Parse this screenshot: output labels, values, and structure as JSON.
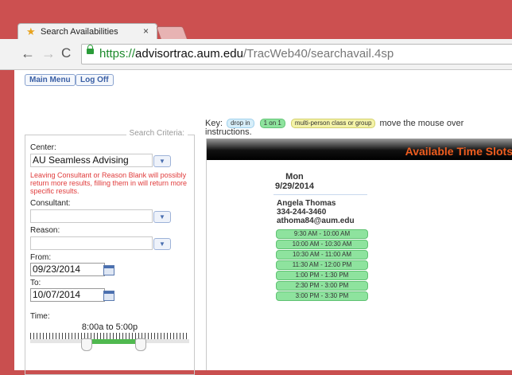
{
  "browser": {
    "tab_title": "Search Availabilities",
    "tab_close": "×",
    "url_scheme": "https://",
    "url_host": "advisortrac.aum.edu",
    "url_path": "/TracWeb40/searchavail.4sp"
  },
  "nav": {
    "main_menu": "Main Menu",
    "log_off": "Log Off"
  },
  "criteria": {
    "legend": "Search Criteria:",
    "center_label": "Center:",
    "center_value": "AU Seamless Advising",
    "warning": "Leaving Consultant or Reason Blank will possibly return more results, filling them in will return more specific results.",
    "consultant_label": "Consultant:",
    "consultant_value": "",
    "reason_label": "Reason:",
    "reason_value": "",
    "from_label": "From:",
    "from_value": "09/23/2014",
    "to_label": "To:",
    "to_value": "10/07/2014",
    "time_label": "Time:",
    "time_range": "8:00a to 5:00p"
  },
  "key": {
    "label": "Key:",
    "drop_in": "drop in",
    "one_on_one": "1 on 1",
    "multi": "multi-person class or group",
    "instructions": "move the mouse over",
    "instructions_tail": "instructions."
  },
  "results": {
    "title": "Available Time Slots",
    "day_name": "Mon",
    "date": "9/29/2014",
    "advisor_name": "Angela Thomas",
    "advisor_phone": "334-244-3460",
    "advisor_email": "athoma84@aum.edu",
    "slots": [
      "9:30 AM - 10:00 AM",
      "10:00 AM - 10:30 AM",
      "10:30 AM - 11:00 AM",
      "11:30 AM - 12:00 PM",
      "1:00 PM - 1:30 PM",
      "2:30 PM - 3:00 PM",
      "3:00 PM - 3:30 PM"
    ]
  },
  "colors": {
    "chrome_red": "#cc5050",
    "one_on_one_green": "#8ee39e",
    "drop_in_blue": "#d7eef9",
    "multi_yellow": "#f4f3a8",
    "title_orange": "#ef5d1f"
  },
  "icons": [
    "back-icon",
    "forward-icon",
    "reload-icon",
    "lock-icon",
    "dropdown-icon",
    "calendar-icon"
  ]
}
